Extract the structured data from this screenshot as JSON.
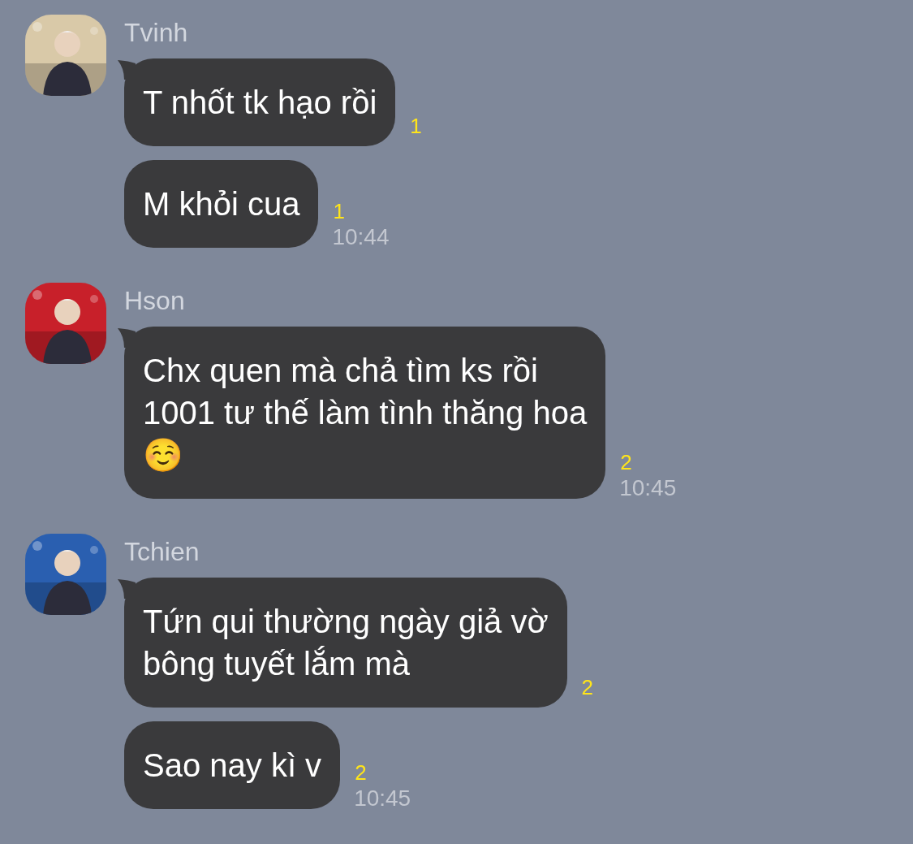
{
  "groups": [
    {
      "sender": "Tvinh",
      "avatar": {
        "kind": "picture"
      },
      "messages": [
        {
          "text": "T nhốt tk hạo rồi",
          "read_count": "1"
        },
        {
          "text": "M khỏi cua",
          "read_count": "1",
          "time": "10:44"
        }
      ]
    },
    {
      "sender": "Hson",
      "avatar": {
        "kind": "picture"
      },
      "messages": [
        {
          "text": "Chx quen mà chả tìm ks rồi\n1001 tư thế làm tình thăng hoa\n☺️",
          "read_count": "2",
          "time": "10:45"
        }
      ]
    },
    {
      "sender": "Tchien",
      "avatar": {
        "kind": "picture"
      },
      "messages": [
        {
          "text": "Tứn qui thường ngày giả vờ\nbông tuyết lắm mà",
          "read_count": "2"
        },
        {
          "text": "Sao nay kì v",
          "read_count": "2",
          "time": "10:45"
        }
      ]
    }
  ]
}
